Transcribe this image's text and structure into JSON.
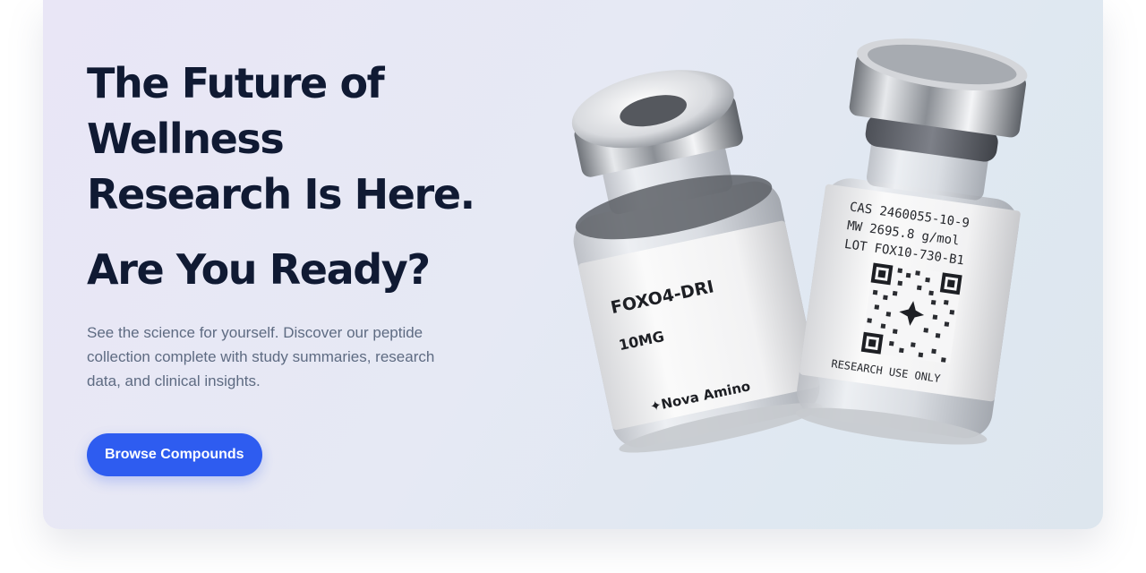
{
  "hero": {
    "headline_lines": [
      "The Future of",
      "Wellness",
      "Research Is Here."
    ],
    "subheadline": "Are You Ready?",
    "description": "See the science for yourself. Discover our peptide collection complete with study summaries, research data, and clinical insights.",
    "cta_label": "Browse Compounds"
  },
  "vial_left": {
    "product_name": "FOXO4-DRI",
    "dose": "10MG",
    "brand": "✦Nova Amino"
  },
  "vial_right": {
    "cas": "CAS 2460055-10-9",
    "mw": "MW 2695.8 g/mol",
    "lot": "LOT FOX10-730-B1",
    "notice": "RESEARCH USE ONLY"
  },
  "colors": {
    "accent": "#2e5cf0",
    "heading": "#101a33",
    "body_text": "#5e6b82",
    "background_start": "#e9e6f6",
    "background_end": "#dde6ee"
  }
}
